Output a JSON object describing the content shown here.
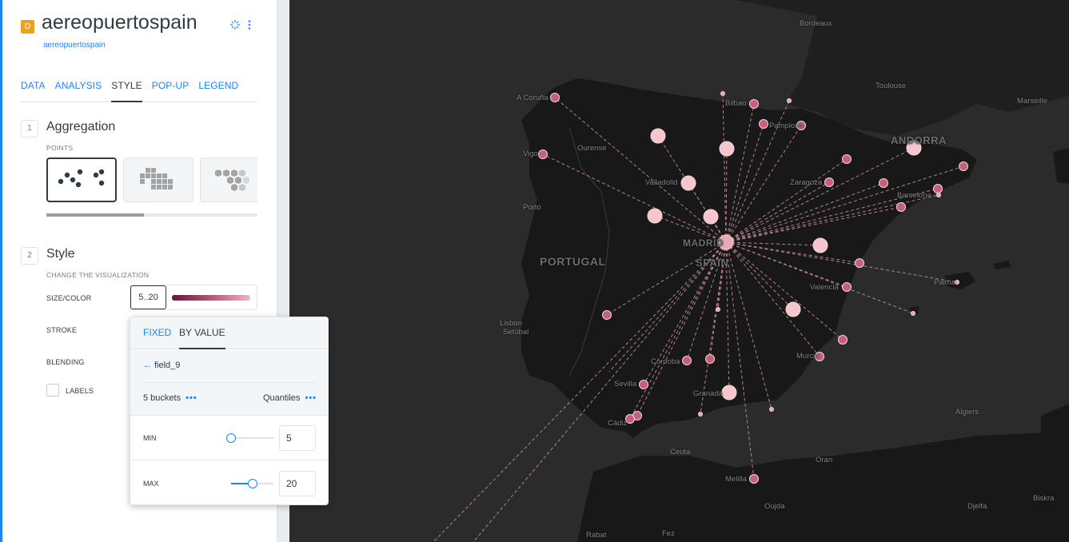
{
  "layer": {
    "badge": "D",
    "title": "aereopuertospain",
    "subtitle": "aereopuertospain"
  },
  "tabs": [
    "DATA",
    "ANALYSIS",
    "STYLE",
    "POP-UP",
    "LEGEND"
  ],
  "active_tab": "STYLE",
  "aggregation": {
    "number": "1",
    "title": "Aggregation",
    "subtitle": "POINTS"
  },
  "style": {
    "number": "2",
    "title": "Style",
    "subtitle": "CHANGE THE VISUALIZATION",
    "size_color_label": "SIZE/COLOR",
    "size_color_value": "5..20",
    "stroke_label": "STROKE",
    "blending_label": "BLENDING",
    "labels_label": "LABELS"
  },
  "popover": {
    "tab_fixed": "FIXED",
    "tab_byvalue": "BY VALUE",
    "field": "field_9",
    "buckets": "5 buckets",
    "quantiles": "Quantiles",
    "min_label": "MIN",
    "min_value": "5",
    "min_slider_level": 0,
    "max_label": "MAX",
    "max_value": "20",
    "max_slider_level": 0.5
  },
  "map": {
    "labels": {
      "bordeaux": "Bordeaux",
      "toulouse": "Toulouse",
      "marseille": "Marseille",
      "acoruna": "A Coruña",
      "bilbao": "Bilbao",
      "pamplona": "Pamplona",
      "ourense": "Ourense",
      "vigo": "Vigo",
      "valladolid": "Valladolid",
      "zaragoza": "Zaragoza",
      "andorra": "ANDORRA",
      "barcelona": "Barcelona",
      "porto": "Porto",
      "portugal": "PORTUGAL",
      "madrid": "MADRID",
      "spain": "SPAIN",
      "valencia": "Valencia",
      "palma": "Palma",
      "lisbon": "Lisbon",
      "setubal": "Setúbal",
      "murcia": "Murcia",
      "cordoba": "Córdoba",
      "sevilla": "Sevilla",
      "granada": "Granada",
      "cadiz": "Cádiz",
      "ceuta": "Ceuta",
      "algiers": "Algiers",
      "oran": "Oran",
      "melilla": "Melilla",
      "oujda": "Oujda",
      "djelfa": "Djelfa",
      "biskra": "Biskra",
      "fez": "Fez",
      "rabat": "Rabat"
    },
    "colors": {
      "background": "#2b2b2b",
      "land": "#181818",
      "point_large": "#f6c6cc",
      "point_small": "#c6607a",
      "line": "#d99aa6"
    }
  }
}
